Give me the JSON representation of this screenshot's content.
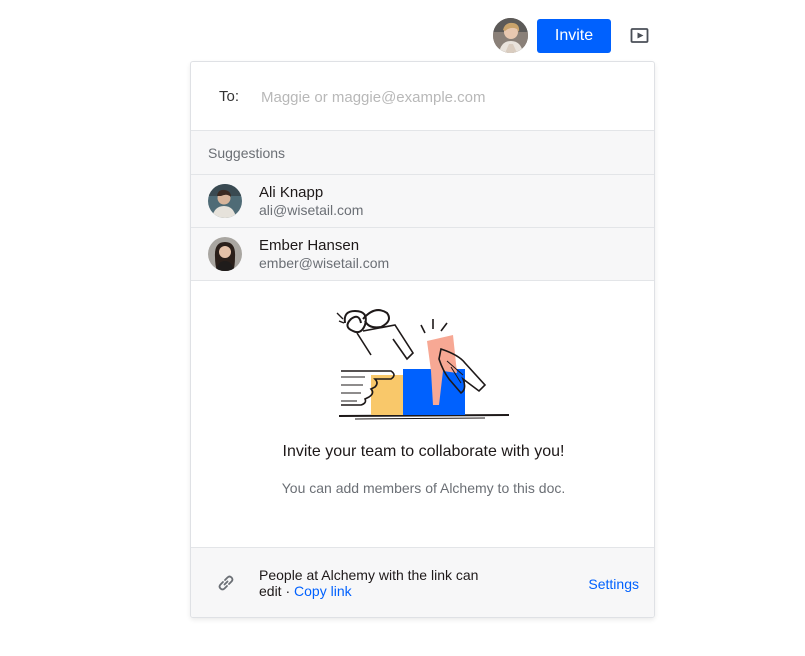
{
  "header": {
    "invite_label": "Invite",
    "current_user_avatar": "user-avatar",
    "present_icon": "present-icon"
  },
  "invite_panel": {
    "to_label": "To:",
    "to_placeholder": "Maggie or maggie@example.com",
    "to_value": "",
    "suggestions_heading": "Suggestions",
    "suggestions": [
      {
        "name": "Ali Knapp",
        "email": "ali@wisetail.com"
      },
      {
        "name": "Ember Hansen",
        "email": "ember@wisetail.com"
      }
    ],
    "empty_state": {
      "title": "Invite your team to collaborate with you!",
      "subtitle": "You can add members of Alchemy to this doc."
    },
    "footer": {
      "share_text": "People at Alchemy with the link can edit",
      "separator": " · ",
      "copy_link_label": "Copy link",
      "settings_label": "Settings",
      "link_icon": "link-icon"
    }
  },
  "colors": {
    "accent": "#0061fe",
    "panel_bg_alt": "#f7f7f8",
    "border": "#e3e5e8",
    "illustration_blue": "#0061fe",
    "illustration_pink": "#f7a894",
    "illustration_yellow": "#f9c86a"
  }
}
